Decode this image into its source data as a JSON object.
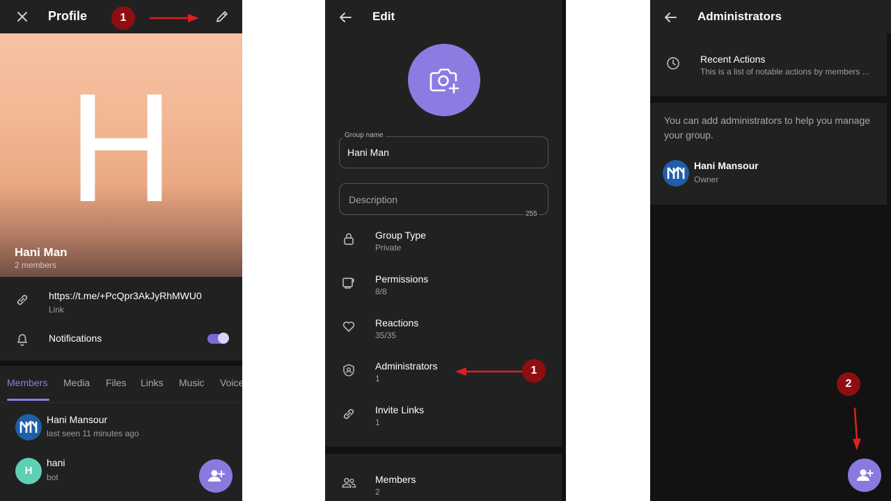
{
  "profile_screen": {
    "title": "Profile",
    "avatar_letter": "H",
    "group_name": "Hani Man",
    "member_count": "2 members",
    "link_url": "https://t.me/+PcQpr3AkJyRhMWU0",
    "link_label": "Link",
    "notifications_label": "Notifications",
    "notifications_on": true,
    "tabs": [
      "Members",
      "Media",
      "Files",
      "Links",
      "Music",
      "Voice"
    ],
    "members": [
      {
        "name": "Hani Mansour",
        "status": "last seen 11 minutes ago"
      },
      {
        "name": "hani",
        "status": "bot",
        "initial": "H"
      }
    ],
    "step_badge": "1"
  },
  "edit_screen": {
    "title": "Edit",
    "group_name_label": "Group name",
    "group_name_value": "Hani Man",
    "description_placeholder": "Description",
    "description_counter": "255",
    "settings": [
      {
        "label": "Group Type",
        "value": "Private",
        "icon": "lock-icon"
      },
      {
        "label": "Permissions",
        "value": "8/8",
        "icon": "permissions-icon"
      },
      {
        "label": "Reactions",
        "value": "35/35",
        "icon": "heart-icon"
      },
      {
        "label": "Administrators",
        "value": "1",
        "icon": "shield-icon"
      },
      {
        "label": "Invite Links",
        "value": "1",
        "icon": "link-icon"
      }
    ],
    "members_label": "Members",
    "members_value": "2",
    "step_badge": "1"
  },
  "admins_screen": {
    "title": "Administrators",
    "recent_actions_title": "Recent Actions",
    "recent_actions_desc": "This is a list of notable actions by members ...",
    "help_text_line1": "You can add administrators to help you manage",
    "help_text_line2": "your group.",
    "admin_name": "Hani Mansour",
    "admin_role": "Owner",
    "step_badge": "2"
  },
  "colors": {
    "accent": "#8a7ae0",
    "badge": "#8e0e12",
    "arrow": "#e01f1f",
    "panel_bg": "#212121"
  }
}
